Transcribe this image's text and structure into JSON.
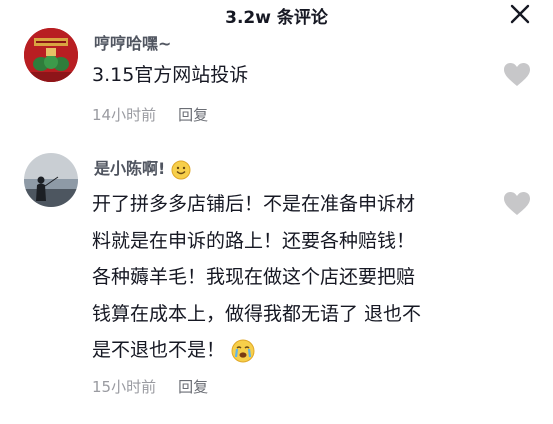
{
  "header": {
    "title": "3.2w 条评论",
    "close_icon": "close-icon"
  },
  "comments": [
    {
      "username": "哼哼哈嘿~",
      "avatar": "avatar-red-festive",
      "text": "3.15官方网站投诉",
      "time": "14小时前",
      "reply_label": "回复",
      "like_icon": "heart-icon"
    },
    {
      "username": "是小陈啊!",
      "username_emoji": "smile-emoji",
      "avatar": "avatar-silhouette-lake",
      "lines": [
        "开了拼多多店铺后！不是在准备申诉材",
        "料就是在申诉的路上！还要各种赔钱！",
        "各种薅羊毛！我现在做这个店还要把赔",
        "钱算在成本上，做得我都无语了 退也不",
        "是不退也不是！"
      ],
      "text_emoji": "crying-emoji",
      "time": "15小时前",
      "reply_label": "回复",
      "like_icon": "heart-icon"
    }
  ],
  "colors": {
    "text": "#161823",
    "username": "#505560",
    "meta": "#9a9ba1",
    "heart": "#c7c7c9"
  }
}
